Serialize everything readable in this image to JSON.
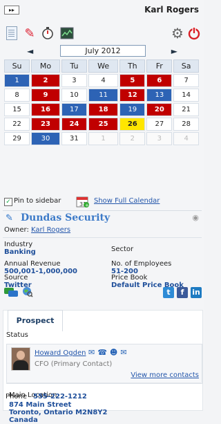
{
  "header": {
    "toggle_label": "▸▸",
    "user_name": "Karl Rogers"
  },
  "toolbar": {
    "icons": [
      "document-icon",
      "pin-icon",
      "stopwatch-icon",
      "chart-icon",
      "gears-icon",
      "power-icon"
    ],
    "power_color": "#d81f26"
  },
  "calendar": {
    "prev": "◄",
    "next": "►",
    "title": "July 2012",
    "days": [
      "Su",
      "Mo",
      "Tu",
      "We",
      "Th",
      "Fr",
      "Sa"
    ],
    "weeks": [
      [
        {
          "d": "1",
          "s": "blue"
        },
        {
          "d": "2",
          "s": "red"
        },
        {
          "d": "3",
          "s": ""
        },
        {
          "d": "4",
          "s": ""
        },
        {
          "d": "5",
          "s": "red"
        },
        {
          "d": "6",
          "s": "red"
        },
        {
          "d": "7",
          "s": ""
        }
      ],
      [
        {
          "d": "8",
          "s": ""
        },
        {
          "d": "9",
          "s": "red"
        },
        {
          "d": "10",
          "s": ""
        },
        {
          "d": "11",
          "s": "blue"
        },
        {
          "d": "12",
          "s": "red"
        },
        {
          "d": "13",
          "s": "blue"
        },
        {
          "d": "14",
          "s": ""
        }
      ],
      [
        {
          "d": "15",
          "s": ""
        },
        {
          "d": "16",
          "s": "red"
        },
        {
          "d": "17",
          "s": "blue"
        },
        {
          "d": "18",
          "s": "red"
        },
        {
          "d": "19",
          "s": "blue"
        },
        {
          "d": "20",
          "s": "red"
        },
        {
          "d": "21",
          "s": ""
        }
      ],
      [
        {
          "d": "22",
          "s": ""
        },
        {
          "d": "23",
          "s": "red"
        },
        {
          "d": "24",
          "s": "red"
        },
        {
          "d": "25",
          "s": "red"
        },
        {
          "d": "26",
          "s": "yellow"
        },
        {
          "d": "27",
          "s": ""
        },
        {
          "d": "28",
          "s": ""
        }
      ],
      [
        {
          "d": "29",
          "s": ""
        },
        {
          "d": "30",
          "s": "blue"
        },
        {
          "d": "31",
          "s": ""
        },
        {
          "d": "1",
          "s": "muted"
        },
        {
          "d": "2",
          "s": "muted"
        },
        {
          "d": "3",
          "s": "muted"
        },
        {
          "d": "4",
          "s": "muted"
        }
      ]
    ],
    "pin_label": "Pin to sidebar",
    "pin_checked": true,
    "full_link": "Show Full Calendar"
  },
  "account": {
    "name": "Dundas Security",
    "owner_label": "Owner:",
    "owner_name": "Karl Rogers",
    "industry_label": "Industry",
    "industry": "Banking",
    "sector_label": "Sector",
    "sector": "",
    "revenue_label": "Annual Revenue",
    "revenue": "500,001-1,000,000",
    "employees_label": "No. of Employees",
    "employees": "51-200",
    "source_label": "Source",
    "source": "Twitter",
    "pricebook_label": "Price Book",
    "pricebook": "Default Price Book"
  },
  "prospect": {
    "tab": "Prospect",
    "status_label": "Status",
    "contact_name": "Howard Ogden",
    "contact_role": "CFO (Primary Contact)",
    "more_contacts": "View more contacts",
    "location_label": "Main Location",
    "address1": "874 Main Street",
    "address2": "Toronto, Ontario M2N8Y2",
    "address3": "Canada",
    "phone_label": "Phone",
    "phone": "555-222-1212"
  }
}
